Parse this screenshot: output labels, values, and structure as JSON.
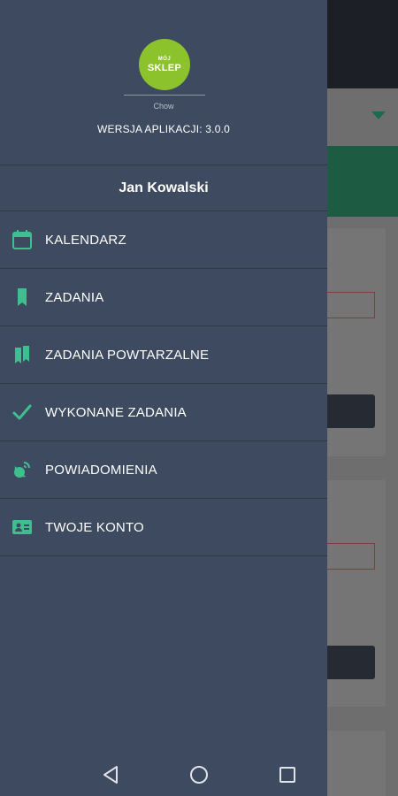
{
  "drawer": {
    "logo": {
      "line1": "MÓJ",
      "line2": "SKLEP"
    },
    "store_name": "Chow",
    "app_version": "WERSJA APLIKACJI: 3.0.0",
    "user_name": "Jan Kowalski",
    "items": [
      {
        "label": "KALENDARZ",
        "icon": "calendar-icon"
      },
      {
        "label": "ZADANIA",
        "icon": "bookmark-icon"
      },
      {
        "label": "ZADANIA POWTARZALNE",
        "icon": "double-bookmark-icon"
      },
      {
        "label": "WYKONANE ZADANIA",
        "icon": "checkmark-icon"
      },
      {
        "label": "POWIADOMIENIA",
        "icon": "satellite-dish-icon"
      },
      {
        "label": "TWOJE KONTO",
        "icon": "id-card-icon"
      }
    ]
  },
  "colors": {
    "drawer_bg": "#3d4a60",
    "accent": "#3fbf8f",
    "logo_green": "#8cc22c"
  },
  "navbar": {
    "back": "back-icon",
    "home": "home-icon",
    "recent": "recent-apps-icon"
  }
}
